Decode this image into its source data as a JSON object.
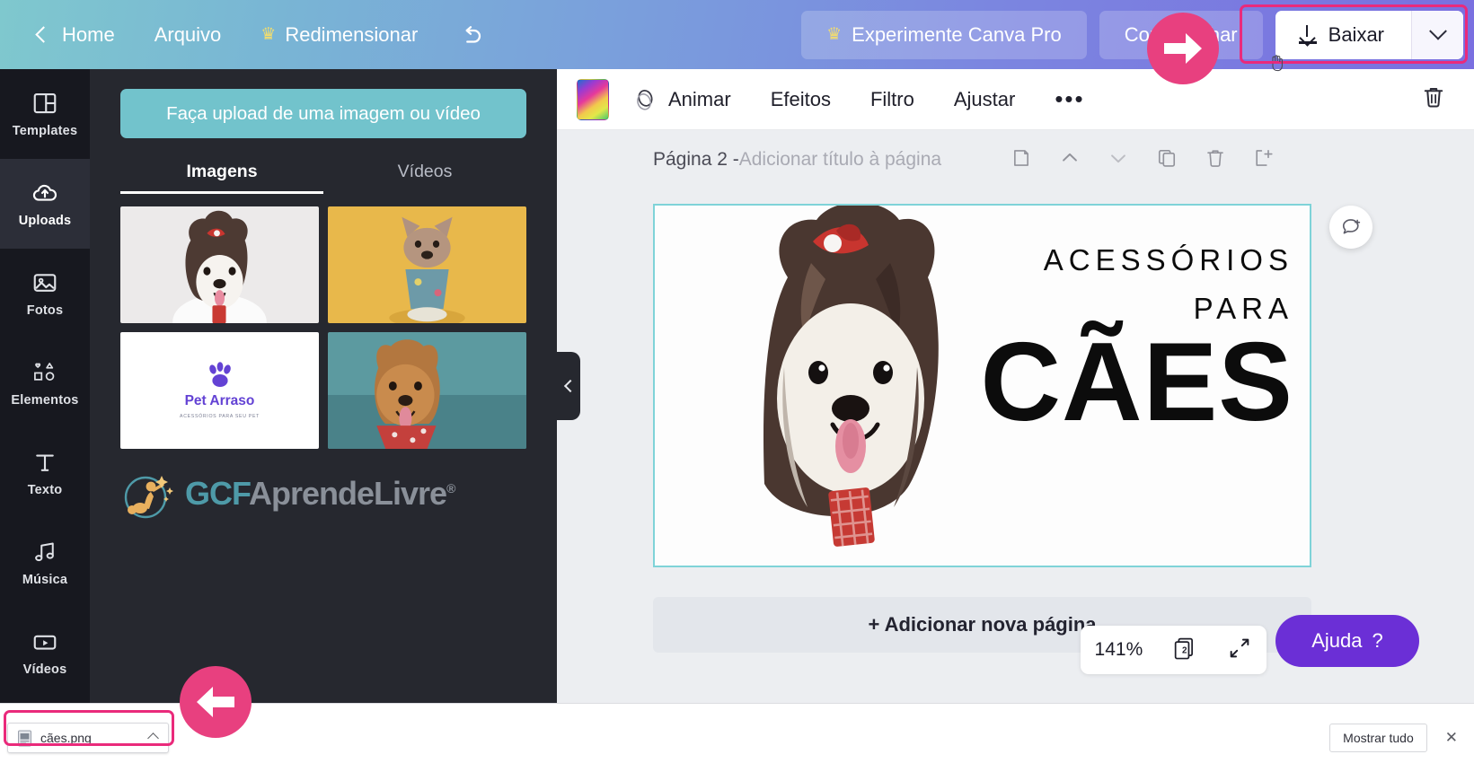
{
  "topbar": {
    "home_label": "Home",
    "file_label": "Arquivo",
    "resize_label": "Redimensionar",
    "undo_icon": "undo-icon",
    "pro_label": "Experimente Canva Pro",
    "share_label": "Compartilhar",
    "download_label": "Baixar",
    "crown_glyph": "♛"
  },
  "sidebar": {
    "items": [
      {
        "label": "Templates",
        "icon": "templates-icon",
        "active": false
      },
      {
        "label": "Uploads",
        "icon": "cloud-upload-icon",
        "active": true
      },
      {
        "label": "Fotos",
        "icon": "photo-icon",
        "active": false
      },
      {
        "label": "Elementos",
        "icon": "shapes-icon",
        "active": false
      },
      {
        "label": "Texto",
        "icon": "text-icon",
        "active": false
      },
      {
        "label": "Música",
        "icon": "music-icon",
        "active": false
      },
      {
        "label": "Vídeos",
        "icon": "video-icon",
        "active": false
      }
    ]
  },
  "panel": {
    "upload_button": "Faça upload de uma imagem ou vídeo",
    "tabs": [
      {
        "label": "Imagens",
        "active": true
      },
      {
        "label": "Vídeos",
        "active": false
      }
    ],
    "thumbnails": [
      {
        "name": "shih-tzu-dog-thumb",
        "alt": "Shih tzu dog with red bow"
      },
      {
        "name": "french-bulldog-thumb",
        "alt": "French bulldog on yellow background"
      },
      {
        "name": "pet-arraso-logo-thumb",
        "alt": "Pet Arraso logo"
      },
      {
        "name": "brown-dog-bandana-thumb",
        "alt": "Brown dog with red bandana"
      }
    ],
    "logo_thumb": {
      "title": "Pet Arraso",
      "subtitle": "ACESSÓRIOS PARA SEU PET"
    },
    "brand": {
      "part1": "GCF",
      "part2": "AprendeLivre",
      "registered": "®"
    },
    "collapse_icon": "chevron-left-icon"
  },
  "editor": {
    "toolbar": {
      "color_swatch": "color-gradient-swatch",
      "animate": "Animar",
      "effects": "Efeitos",
      "filter": "Filtro",
      "adjust": "Ajustar",
      "more": "•••",
      "trash_icon": "trash-icon"
    },
    "page": {
      "title": "Página 2 - ",
      "subtitle": "Adicionar título à página",
      "tools": [
        {
          "name": "notes-icon",
          "dim": false
        },
        {
          "name": "move-up-icon",
          "dim": false
        },
        {
          "name": "move-down-icon",
          "dim": true
        },
        {
          "name": "duplicate-icon",
          "dim": false
        },
        {
          "name": "delete-page-icon",
          "dim": false
        },
        {
          "name": "add-page-icon",
          "dim": false
        }
      ]
    },
    "design": {
      "line1": "ACESSÓRIOS",
      "line2": "PARA",
      "line3": "CÃES",
      "image_alt": "Shih tzu dog with red bow and red checkered tag"
    },
    "comment_icon": "add-comment-icon",
    "add_page_label": "+ Adicionar nova página",
    "zoom_level": "141%",
    "page_count": "2",
    "expand_icon": "fullscreen-icon",
    "help_label": "Ajuda",
    "help_question": "?"
  },
  "download_bar": {
    "file_name": "cães.png",
    "file_icon": "png-file-icon",
    "expand_icon": "chevron-up-icon",
    "show_all": "Mostrar tudo",
    "close_icon": "close-icon"
  },
  "annotations": {
    "arrow_right": "pink-arrow-right",
    "arrow_left": "pink-arrow-left",
    "highlight_color": "#ea2a7b"
  }
}
